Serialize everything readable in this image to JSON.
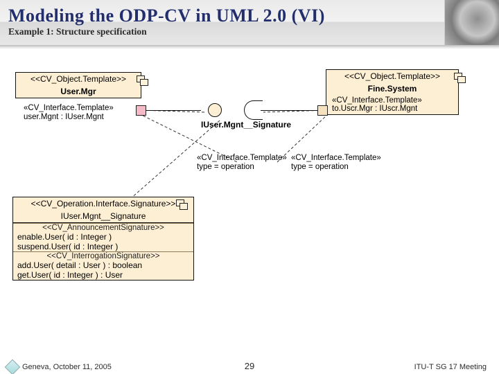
{
  "header": {
    "title": "Modeling the ODP-CV in UML 2.0 (VI)",
    "subtitle": "Example 1: Structure specification"
  },
  "diagram": {
    "usermgr": {
      "stereotype": "<<CV_Object.Template>>",
      "name": "User.Mgr",
      "iface_stereo": "«CV_Interface.Template»",
      "iface": "user.Mgnt : IUser.Mgnt"
    },
    "finesys": {
      "stereotype": "<<CV_Object.Template>>",
      "name": "Fine.System",
      "iface_stereo": "«CV_Interface.Template»",
      "iface": "to.Uscr.Mgr : IUscr.Mgnt"
    },
    "lollipop_label": "IUser.Mgnt__Signature",
    "left_note": {
      "stereo": "«CV_Interface.Template»",
      "body": "type = operation"
    },
    "right_note": {
      "stereo": "«CV_Interface.Template»",
      "body": "type = operation"
    },
    "sigbox": {
      "title_stereo": "<<CV_Operation.Interface.Signature>>",
      "title_name": "IUser.Mgnt__Signature",
      "ann1": "<<CV_AnnouncementSignature>>",
      "op1": "enable.User( id : Integer )",
      "op2": "suspend.User( id : Integer )",
      "ann2": "<<CV_InterrogationSignature>>",
      "op3": "add.User( detail : User ) : boolean",
      "op4": "get.User( id : Integer ) : User"
    }
  },
  "footer": {
    "left": "Geneva, October 11, 2005",
    "center": "29",
    "right": "ITU-T SG 17 Meeting"
  }
}
